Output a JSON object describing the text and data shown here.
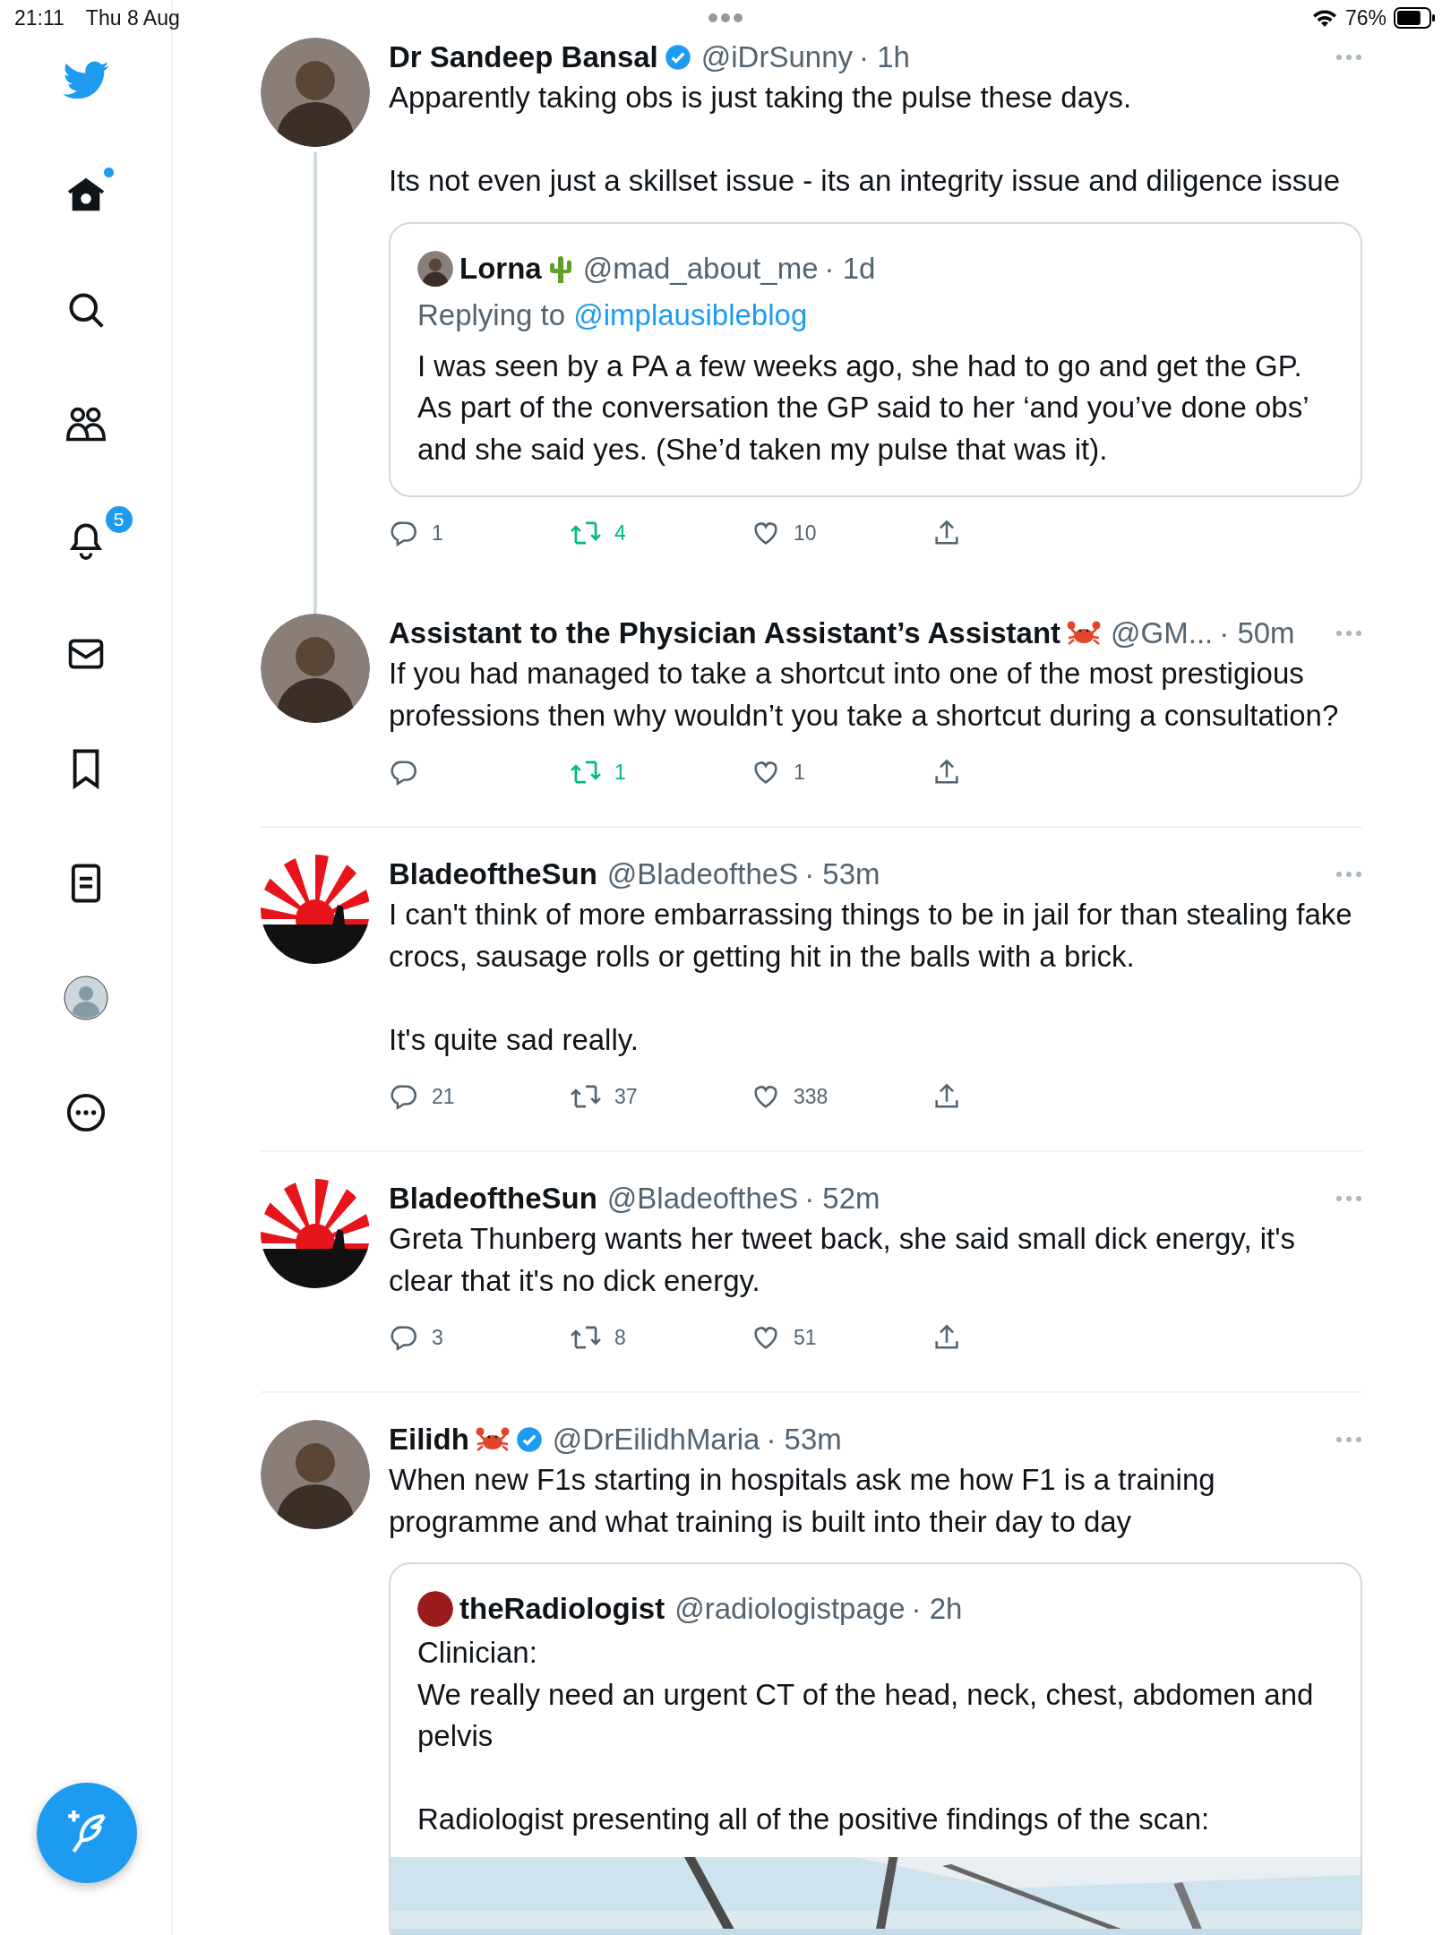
{
  "status_bar": {
    "time": "21:11",
    "date": "Thu 8 Aug",
    "battery": "76%"
  },
  "sidebar": {
    "items": [
      {
        "kind": "home",
        "selected": true,
        "new_dot": true
      },
      {
        "kind": "search",
        "selected": false
      },
      {
        "kind": "communities",
        "selected": false
      },
      {
        "kind": "notifications",
        "selected": false,
        "badge": "5"
      },
      {
        "kind": "messages",
        "selected": false
      },
      {
        "kind": "bookmarks",
        "selected": false
      },
      {
        "kind": "lists",
        "selected": false
      },
      {
        "kind": "profile",
        "selected": false
      },
      {
        "kind": "more",
        "selected": false
      }
    ]
  },
  "tweets": [
    {
      "name": "Dr Sandeep Bansal",
      "verified": true,
      "handle": "@iDrSunny",
      "time": "· 1h",
      "connected_below": true,
      "text": "Apparently taking obs is just taking the pulse these days.\n\nIts not even just a skillset issue - its an integrity issue and diligence issue",
      "quote": {
        "name": "Lorna",
        "handle": "@mad_about_me",
        "time": "· 1d",
        "replying_label": "Replying to",
        "replying_to": "@implausibleblog",
        "text": "I was seen by a PA a few weeks ago, she had to go and get the GP. As part of the conversation the GP said to her ‘and you’ve done obs’ and she said yes. (She’d taken my pulse that was it)."
      },
      "actions": {
        "replies": "1",
        "retweets": "4",
        "retweeted": true,
        "likes": "10"
      }
    },
    {
      "name": "Assistant to the Physician Assistant’s Assistant",
      "verified": false,
      "handle": "@GM...",
      "time": "· 50m",
      "connected_below": false,
      "text": "If you had managed to take a shortcut into one of the most prestigious professions then why wouldn’t you take a shortcut during a consultation?",
      "actions": {
        "retweets": "1",
        "retweeted": true,
        "likes": "1"
      }
    },
    {
      "name": "BladeoftheSun",
      "verified": false,
      "handle": "@BladeoftheS",
      "time": "· 53m",
      "connected_below": false,
      "text": "I can't think of more embarrassing things to be in jail for than stealing fake crocs, sausage rolls or getting hit in the balls with a brick.\n\nIt's quite sad really.",
      "actions": {
        "replies": "21",
        "retweets": "37",
        "retweeted": false,
        "likes": "338"
      }
    },
    {
      "name": "BladeoftheSun",
      "verified": false,
      "handle": "@BladeoftheS",
      "time": "· 52m",
      "connected_below": false,
      "text": "Greta Thunberg wants her tweet back, she said small dick energy, it's clear that it's no dick energy.",
      "actions": {
        "replies": "3",
        "retweets": "8",
        "retweeted": false,
        "likes": "51"
      }
    },
    {
      "name": "Eilidh",
      "verified": true,
      "handle": "@DrEilidhMaria",
      "time": "· 53m",
      "connected_below": false,
      "text": "When new F1s starting in hospitals ask me how F1 is a training programme and what training is built into their day to day",
      "quote": {
        "name": "theRadiologist",
        "handle": "@radiologistpage",
        "time": "· 2h",
        "text": "Clinician:\nWe really need an urgent CT of the head, neck, chest, abdomen and pelvis\n\nRadiologist presenting all of the positive findings of the scan:"
      }
    }
  ]
}
